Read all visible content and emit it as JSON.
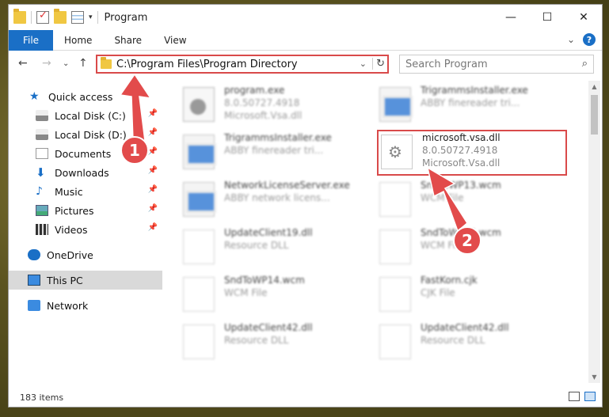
{
  "window": {
    "title": "Program",
    "controls": {
      "minimize": "—",
      "maximize": "☐",
      "close": "✕"
    }
  },
  "ribbon": {
    "tabs": [
      "File",
      "Home",
      "Share",
      "View"
    ],
    "expand": "⌄",
    "help": "?"
  },
  "address": {
    "path": "C:\\Program Files\\Program Directory",
    "dropdown": "⌄",
    "refresh": "↻"
  },
  "search": {
    "placeholder": "Search Program",
    "icon": "⌕"
  },
  "nav": {
    "back": "←",
    "forward": "→",
    "recent": "⌄",
    "up": "↑"
  },
  "navpane": {
    "items": [
      {
        "label": "Quick access",
        "icon": "star-icon"
      },
      {
        "label": "Local Disk (C:)",
        "icon": "drive-icon",
        "pinned": true
      },
      {
        "label": "Local Disk (D:)",
        "icon": "drive-icon",
        "pinned": true
      },
      {
        "label": "Documents",
        "icon": "documents-icon",
        "pinned": true
      },
      {
        "label": "Downloads",
        "icon": "download-icon",
        "pinned": true
      },
      {
        "label": "Music",
        "icon": "music-icon",
        "pinned": true
      },
      {
        "label": "Pictures",
        "icon": "pictures-icon",
        "pinned": true
      },
      {
        "label": "Videos",
        "icon": "videos-icon",
        "pinned": true
      },
      {
        "label": "OneDrive",
        "icon": "cloud-icon"
      },
      {
        "label": "This PC",
        "icon": "computer-icon",
        "selected": true
      },
      {
        "label": "Network",
        "icon": "network-icon"
      }
    ]
  },
  "files": [
    {
      "name": "program.exe",
      "line2": "8.0.50727.4918",
      "line3": "Microsoft.Vsa.dll",
      "icon": "exe"
    },
    {
      "name": "TrigrammsInstaller.exe",
      "line2": "ABBY finereader tri...",
      "line3": "",
      "icon": "win"
    },
    {
      "name": "TrigrammsInstaller.exe",
      "line2": "ABBY finereader tri...",
      "line3": "",
      "icon": "win"
    },
    {
      "name": "microsoft.vsa.dll",
      "line2": "8.0.50727.4918",
      "line3": "Microsoft.Vsa.dll",
      "icon": "dll"
    },
    {
      "name": "NetworkLicenseServer.exe",
      "line2": "ABBY network licens...",
      "line3": "",
      "icon": "win"
    },
    {
      "name": "SndToWP13.wcm",
      "line2": "WCM File",
      "line3": "",
      "icon": "doc"
    },
    {
      "name": "UpdateClient19.dll",
      "line2": "Resource DLL",
      "line3": "",
      "icon": "doc"
    },
    {
      "name": "SndToWP14.wcm",
      "line2": "WCM File",
      "line3": "",
      "icon": "doc"
    },
    {
      "name": "SndToWP14.wcm",
      "line2": "WCM File",
      "line3": "",
      "icon": "doc"
    },
    {
      "name": "FastKorn.cjk",
      "line2": "CJK File",
      "line3": "",
      "icon": "doc"
    },
    {
      "name": "UpdateClient42.dll",
      "line2": "Resource DLL",
      "line3": "",
      "icon": "doc"
    },
    {
      "name": "UpdateClient42.dll",
      "line2": "Resource DLL",
      "line3": "",
      "icon": "doc"
    }
  ],
  "status": {
    "count": "183 items"
  },
  "markers": [
    "1",
    "2"
  ],
  "colors": {
    "accent": "#1a6fc6",
    "annotation": "#e24b4b"
  }
}
